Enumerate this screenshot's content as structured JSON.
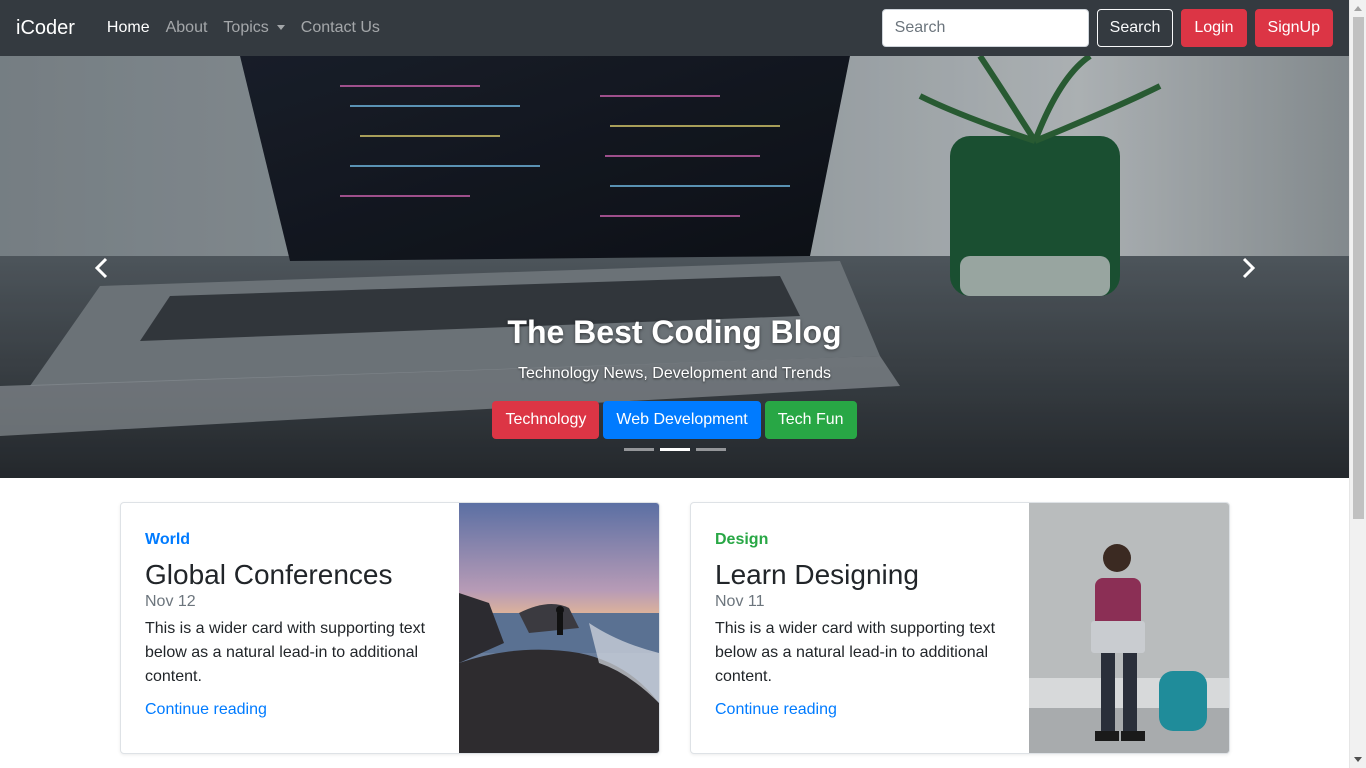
{
  "navbar": {
    "brand": "iCoder",
    "links": [
      {
        "label": "Home",
        "active": true
      },
      {
        "label": "About",
        "active": false
      },
      {
        "label": "Topics",
        "active": false,
        "dropdown": true
      },
      {
        "label": "Contact Us",
        "active": false
      }
    ],
    "search": {
      "placeholder": "Search",
      "value": ""
    },
    "search_button": "Search",
    "login_button": "Login",
    "signup_button": "SignUp"
  },
  "carousel": {
    "title": "The Best Coding Blog",
    "subtitle": "Technology News, Development and Trends",
    "buttons": [
      "Technology",
      "Web Development",
      "Tech Fun"
    ],
    "active_slide": 2,
    "slide_count": 3,
    "prev_icon": "chevron-left-icon",
    "next_icon": "chevron-right-icon"
  },
  "cards": [
    {
      "category": "World",
      "category_color": "#007bff",
      "title": "Global Conferences",
      "date": "Nov 12",
      "text": "This is a wider card with supporting text below as a natural lead-in to additional content.",
      "link": "Continue reading"
    },
    {
      "category": "Design",
      "category_color": "#28a745",
      "title": "Learn Designing",
      "date": "Nov 11",
      "text": "This is a wider card with supporting text below as a natural lead-in to additional content.",
      "link": "Continue reading"
    }
  ],
  "colors": {
    "navbar_bg": "#343a40",
    "danger": "#dc3545",
    "primary": "#007bff",
    "success": "#28a745"
  }
}
